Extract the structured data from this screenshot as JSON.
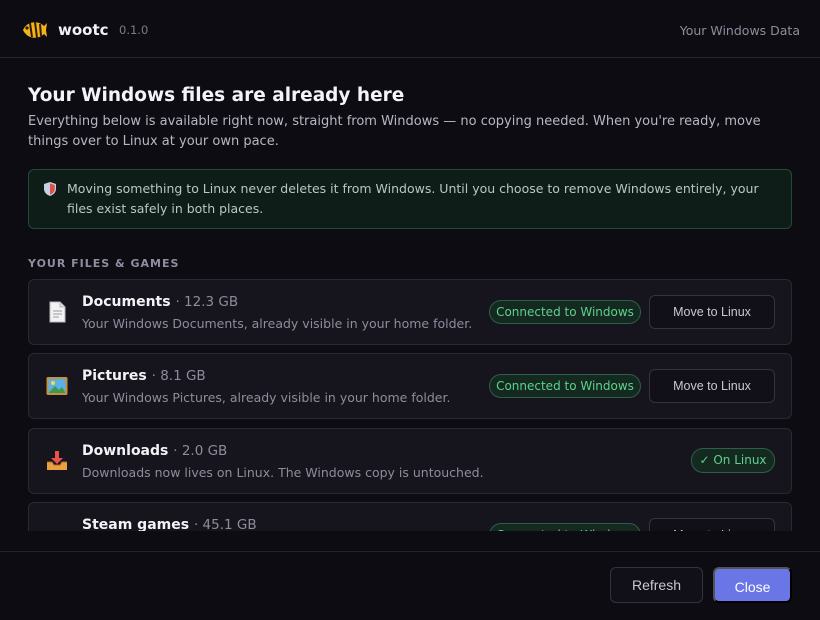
{
  "header": {
    "app_name": "wootc",
    "version": "0.1.0",
    "right_label": "Your Windows Data",
    "logo_icon": "fish-icon"
  },
  "main": {
    "title": "Your Windows files are already here",
    "subtitle": "Everything below is available right now, straight from Windows — no copying needed. When you're ready, move things over to Linux at your own pace.",
    "notice": {
      "icon": "shield-icon",
      "text": "Moving something to Linux never deletes it from Windows. Until you choose to remove Windows entirely, your files exist safely in both places."
    },
    "section_label": "YOUR FILES & GAMES",
    "items": [
      {
        "name": "Documents",
        "size": "· 12.3 GB",
        "description": "Your Windows Documents, already visible in your home folder.",
        "icon": "document-icon",
        "status": "Connected to Windows",
        "action": "Move to Linux"
      },
      {
        "name": "Pictures",
        "size": "· 8.1 GB",
        "description": "Your Windows Pictures, already visible in your home folder.",
        "icon": "picture-icon",
        "status": "Connected to Windows",
        "action": "Move to Linux"
      },
      {
        "name": "Downloads",
        "size": "· 2.0 GB",
        "description": "Downloads now lives on Linux. The Windows copy is untouched.",
        "icon": "inbox-tray-icon",
        "status": "✓ On Linux"
      },
      {
        "name": "Steam games",
        "size": "· 45.1 GB",
        "description": "",
        "icon": "game-controller-icon",
        "status": "Connected to Windows",
        "action": "Move to Linux"
      }
    ]
  },
  "footer": {
    "refresh_label": "Refresh",
    "close_label": "Close"
  },
  "colors": {
    "accent": "#6a75e6",
    "success": "#5fd08c",
    "background": "#0d0c12",
    "card": "#16151d"
  }
}
